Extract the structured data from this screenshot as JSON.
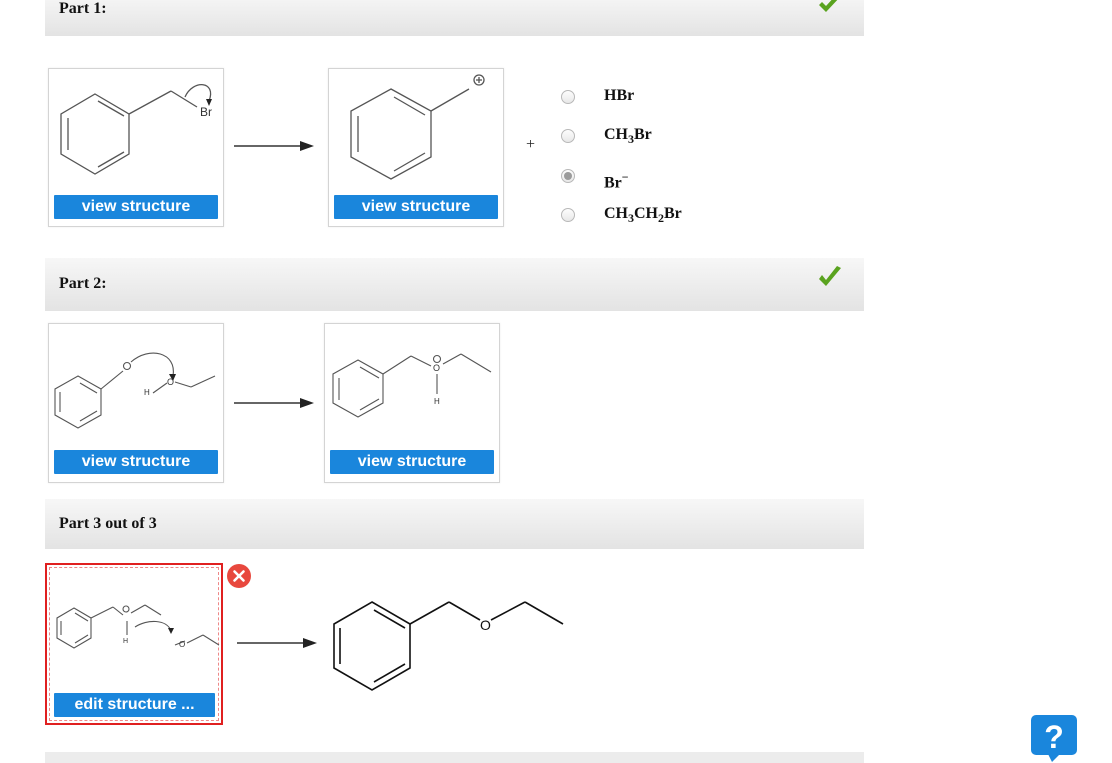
{
  "part1": {
    "title": "Part 1:",
    "status": "check-icon"
  },
  "part2": {
    "title": "Part 2:",
    "status": "check-icon"
  },
  "part3": {
    "title": "Part 3 out of 3"
  },
  "buttons": {
    "view_structure": "view structure",
    "edit_structure": "edit structure ..."
  },
  "structure_labels": {
    "br": "Br",
    "plus_charge": "⊕",
    "o": "O",
    "h": "H",
    "colon": ":"
  },
  "plus_sign": "+",
  "options": [
    {
      "main": "HBr",
      "parts": [
        {
          "t": "HBr"
        }
      ],
      "selected": false
    },
    {
      "main": "CH3Br",
      "parts": [
        {
          "t": "CH"
        },
        {
          "sub": "3"
        },
        {
          "t": "Br"
        }
      ],
      "selected": false
    },
    {
      "main": "Br-",
      "parts": [
        {
          "t": "Br"
        },
        {
          "sup": "−"
        }
      ],
      "selected": true
    },
    {
      "main": "CH3CH2Br",
      "parts": [
        {
          "t": "CH"
        },
        {
          "sub": "3"
        },
        {
          "t": "CH"
        },
        {
          "sub": "2"
        },
        {
          "t": "Br"
        }
      ],
      "selected": false
    }
  ],
  "colors": {
    "accent": "#1a86dc",
    "check": "#5aa31f",
    "error": "#e02020",
    "delete": "#e8483e"
  },
  "icons": [
    "check-icon",
    "delete-icon",
    "help-icon",
    "arrow-icon"
  ]
}
